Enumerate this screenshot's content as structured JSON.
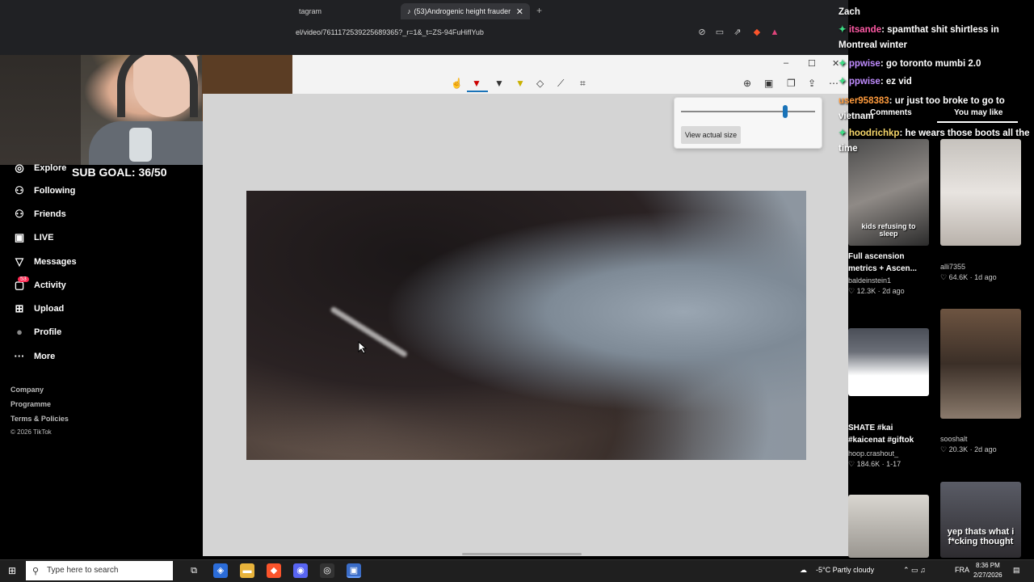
{
  "browser": {
    "tabs": [
      {
        "label": "tagram"
      },
      {
        "label": "(53)Androgenic height frauder",
        "close": "✕"
      }
    ],
    "new_tab": "+",
    "address": "el/video/7611172539225689365?_r=1&_t=ZS-94FuHiflYub"
  },
  "viewer": {
    "zoom_button": "View actual size",
    "zoom_level": 0.78,
    "window_controls": [
      "–",
      "☐",
      "✕"
    ]
  },
  "sidebar": {
    "sub_goal": "SUB GOAL: 36/50",
    "items": [
      {
        "label": "Explore",
        "icon": "compass-icon",
        "glyph": "◎"
      },
      {
        "label": "Following",
        "icon": "following-icon",
        "glyph": "⚇"
      },
      {
        "label": "Friends",
        "icon": "friends-icon",
        "glyph": "⚇"
      },
      {
        "label": "LIVE",
        "icon": "live-icon",
        "glyph": "▣"
      },
      {
        "label": "Messages",
        "icon": "messages-icon",
        "glyph": "▽"
      },
      {
        "label": "Activity",
        "icon": "activity-icon",
        "glyph": "▢",
        "badge": "53"
      },
      {
        "label": "Upload",
        "icon": "upload-icon",
        "glyph": "⊞"
      },
      {
        "label": "Profile",
        "icon": "avatar",
        "glyph": "●"
      },
      {
        "label": "More",
        "icon": "more-icon",
        "glyph": "···"
      }
    ],
    "footer": [
      "Company",
      "Programme",
      "Terms & Policies"
    ],
    "copyright": "© 2026 TikTok"
  },
  "chat": {
    "lines": [
      {
        "user": "",
        "text": "Zach"
      },
      {
        "user": "itsande",
        "text": ": spamthat shit shirtless in Montreal winter"
      },
      {
        "user": "ppwise",
        "text": ": go toronto mumbi 2.0"
      },
      {
        "user": "ppwise",
        "text": ": ez vid"
      },
      {
        "user": "user958383",
        "text": ": ur just too broke to go to vietnam"
      },
      {
        "user": "hoodrichkp",
        "text": ": he wears those boots all the time"
      }
    ]
  },
  "right_panel": {
    "tabs": [
      "Comments",
      "You may like"
    ],
    "videos": [
      {
        "title": "Full ascension metrics + Ascen...",
        "author": "baldeinstein1",
        "stats": "♡ 12.3K · 2d ago",
        "overlay": "kids refusing to sleep"
      },
      {
        "title": "",
        "author": "alli7355",
        "stats": "♡ 64.6K · 1d ago",
        "overlay": ""
      },
      {
        "title": "SHATE #kai #kaicenat #giftok",
        "author": "hoop.crashout_",
        "stats": "♡ 184.6K · 1-17",
        "overlay": ""
      },
      {
        "title": "",
        "author": "sooshalt",
        "stats": "♡ 20.3K · 2d ago",
        "overlay": ""
      },
      {
        "title": "",
        "author": "",
        "stats": "",
        "overlay": ""
      },
      {
        "title": "",
        "author": "",
        "stats": "",
        "overlay": "yep thats what i f*cking thought"
      }
    ]
  },
  "taskbar": {
    "search_placeholder": "Type here to search",
    "weather": "-5°C  Partly cloudy",
    "language": "FRA",
    "time": "8:36 PM",
    "date": "2/27/2026"
  }
}
